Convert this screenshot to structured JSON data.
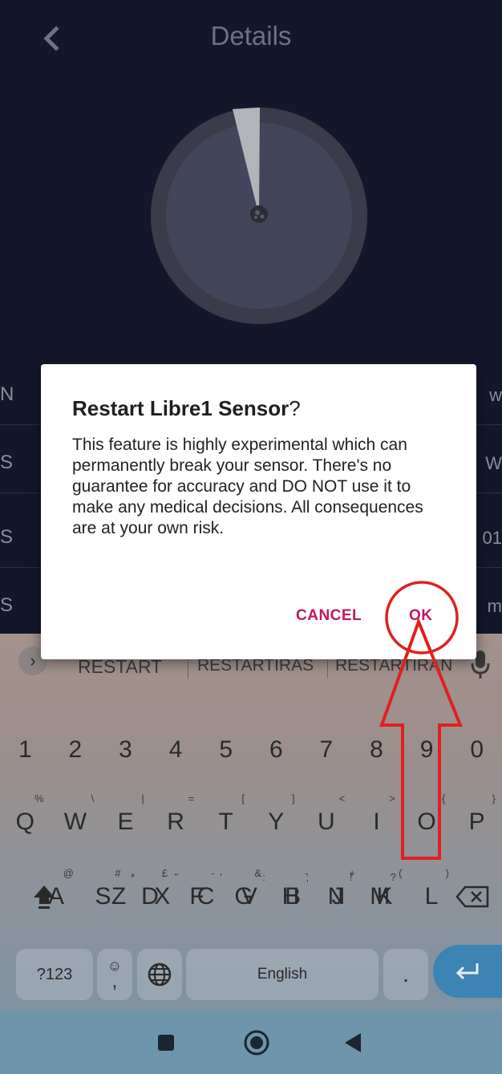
{
  "app": {
    "title": "Details",
    "rows": [
      {
        "label": "N",
        "value": "w"
      },
      {
        "label": "S",
        "value": "W"
      },
      {
        "label": "S",
        "value": "01"
      },
      {
        "label": "S",
        "value": "m"
      }
    ]
  },
  "dialog": {
    "title_main": "Restart Libre1 Sensor",
    "title_mark": "?",
    "body": "This feature is highly experimental which can permanently break your sensor. There's no guarantee for accuracy and DO NOT use it to make any medical decisions. All consequences are at your own risk.",
    "cancel": "CANCEL",
    "ok": "OK"
  },
  "keyboard": {
    "suggestions": [
      "RESTART",
      "RESTARTIRAS",
      "RESTARTIRAN"
    ],
    "number_row": [
      "1",
      "2",
      "3",
      "4",
      "5",
      "6",
      "7",
      "8",
      "9",
      "0"
    ],
    "row1": [
      "Q",
      "W",
      "E",
      "R",
      "T",
      "Y",
      "U",
      "I",
      "O",
      "P"
    ],
    "row1_sup": [
      "%",
      "\\",
      "|",
      "=",
      "[",
      "]",
      "<",
      ">",
      "{",
      "}"
    ],
    "row2": [
      "A",
      "S",
      "D",
      "F",
      "G",
      "H",
      "J",
      "K",
      "L"
    ],
    "row2_sup": [
      "@",
      "#",
      "£",
      "-",
      "&",
      "-",
      "+",
      "(",
      ")"
    ],
    "row3": [
      "Z",
      "X",
      "C",
      "V",
      "B",
      "N",
      "M"
    ],
    "row3_sup": [
      "*",
      "\"",
      "'",
      ":",
      ";",
      "!",
      "?"
    ],
    "symbols_key": "?123",
    "comma_key": ",",
    "space_label": "English",
    "period_key": "."
  },
  "colors": {
    "background": "#14172c",
    "accent": "#c2185b",
    "annotation": "#e02020",
    "enter_key": "#3b84b3"
  },
  "icons": {
    "back": "chevron-left-icon",
    "mic": "mic-icon",
    "shift": "shift-icon",
    "backspace": "backspace-icon",
    "globe": "globe-icon",
    "emoji": "emoji-icon",
    "enter": "enter-icon",
    "nav_recents": "square-icon",
    "nav_home": "circle-icon",
    "nav_back": "triangle-back-icon"
  }
}
